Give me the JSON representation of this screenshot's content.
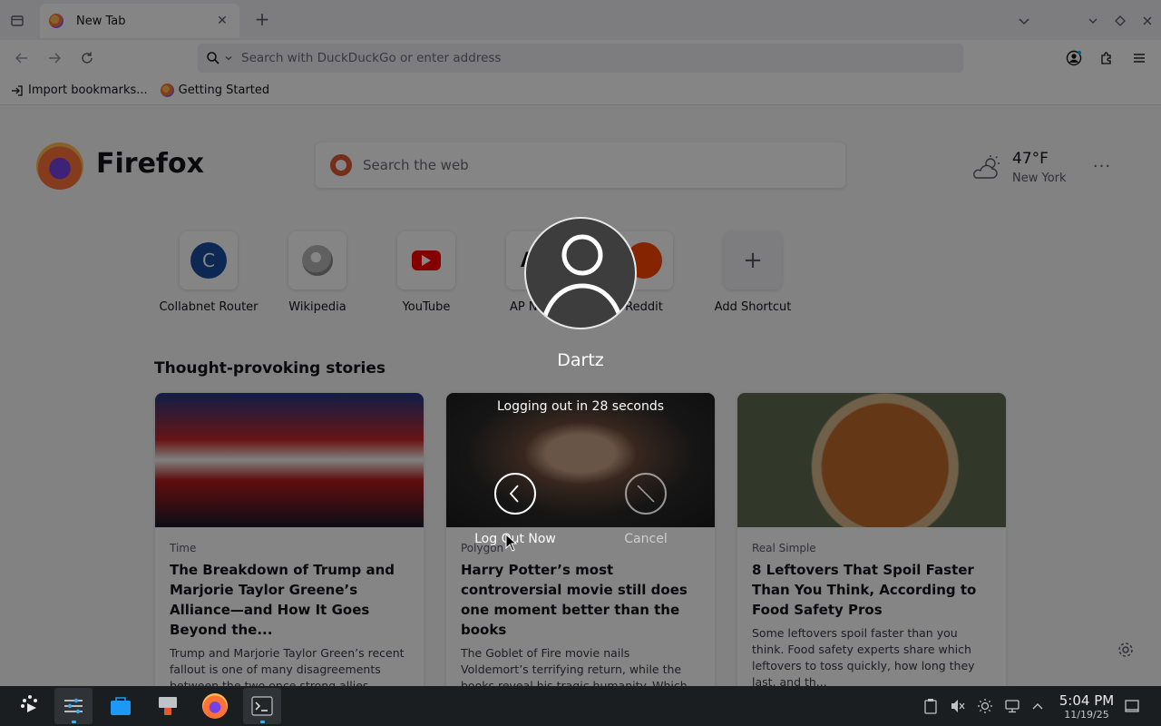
{
  "browser": {
    "tab": {
      "title": "New Tab"
    },
    "urlbar": {
      "placeholder": "Search with DuckDuckGo or enter address"
    },
    "bookmarks": [
      {
        "label": "Import bookmarks..."
      },
      {
        "label": "Getting Started"
      }
    ]
  },
  "ntp": {
    "brand": "Firefox",
    "search_placeholder": "Search the web",
    "weather": {
      "temp": "47°F",
      "city": "New York"
    },
    "shortcuts": [
      {
        "label": "Collabnet Router",
        "letter": "C"
      },
      {
        "label": "Wikipedia"
      },
      {
        "label": "YouTube"
      },
      {
        "label": "AP News",
        "logo_text": "AP"
      },
      {
        "label": "Reddit"
      },
      {
        "label": "Add Shortcut"
      }
    ],
    "stories_heading": "Thought-provoking stories",
    "stories": [
      {
        "source": "Time",
        "title": "The Breakdown of Trump and Marjorie Taylor Greene’s Alliance—and How It Goes Beyond the...",
        "excerpt": "Trump and Marjorie Taylor Green’s recent fallout is one of many disagreements between the two once strong allies."
      },
      {
        "source": "Polygon",
        "title": "Harry Potter’s most controversial movie still does one moment better than the books",
        "excerpt": "The Goblet of Fire movie nails Voldemort’s terrifying return, while the books reveal his tragic humanity. Which version got it right?"
      },
      {
        "source": "Real Simple",
        "title": "8 Leftovers That Spoil Faster Than You Think, According to Food Safety Pros",
        "excerpt": "Some leftovers spoil faster than you think. Food safety experts share which leftovers to toss quickly, how long they last, and th..."
      }
    ]
  },
  "logout_dialog": {
    "user_name": "Dartz",
    "countdown": "Logging out in 28 seconds",
    "logout_label": "Log Out Now",
    "cancel_label": "Cancel"
  },
  "taskbar": {
    "time": "5:04 PM",
    "date": "11/19/25"
  },
  "colors": {
    "overlay": "#000000",
    "taskbar": "#1b1e20",
    "accent": "#3daee9"
  }
}
